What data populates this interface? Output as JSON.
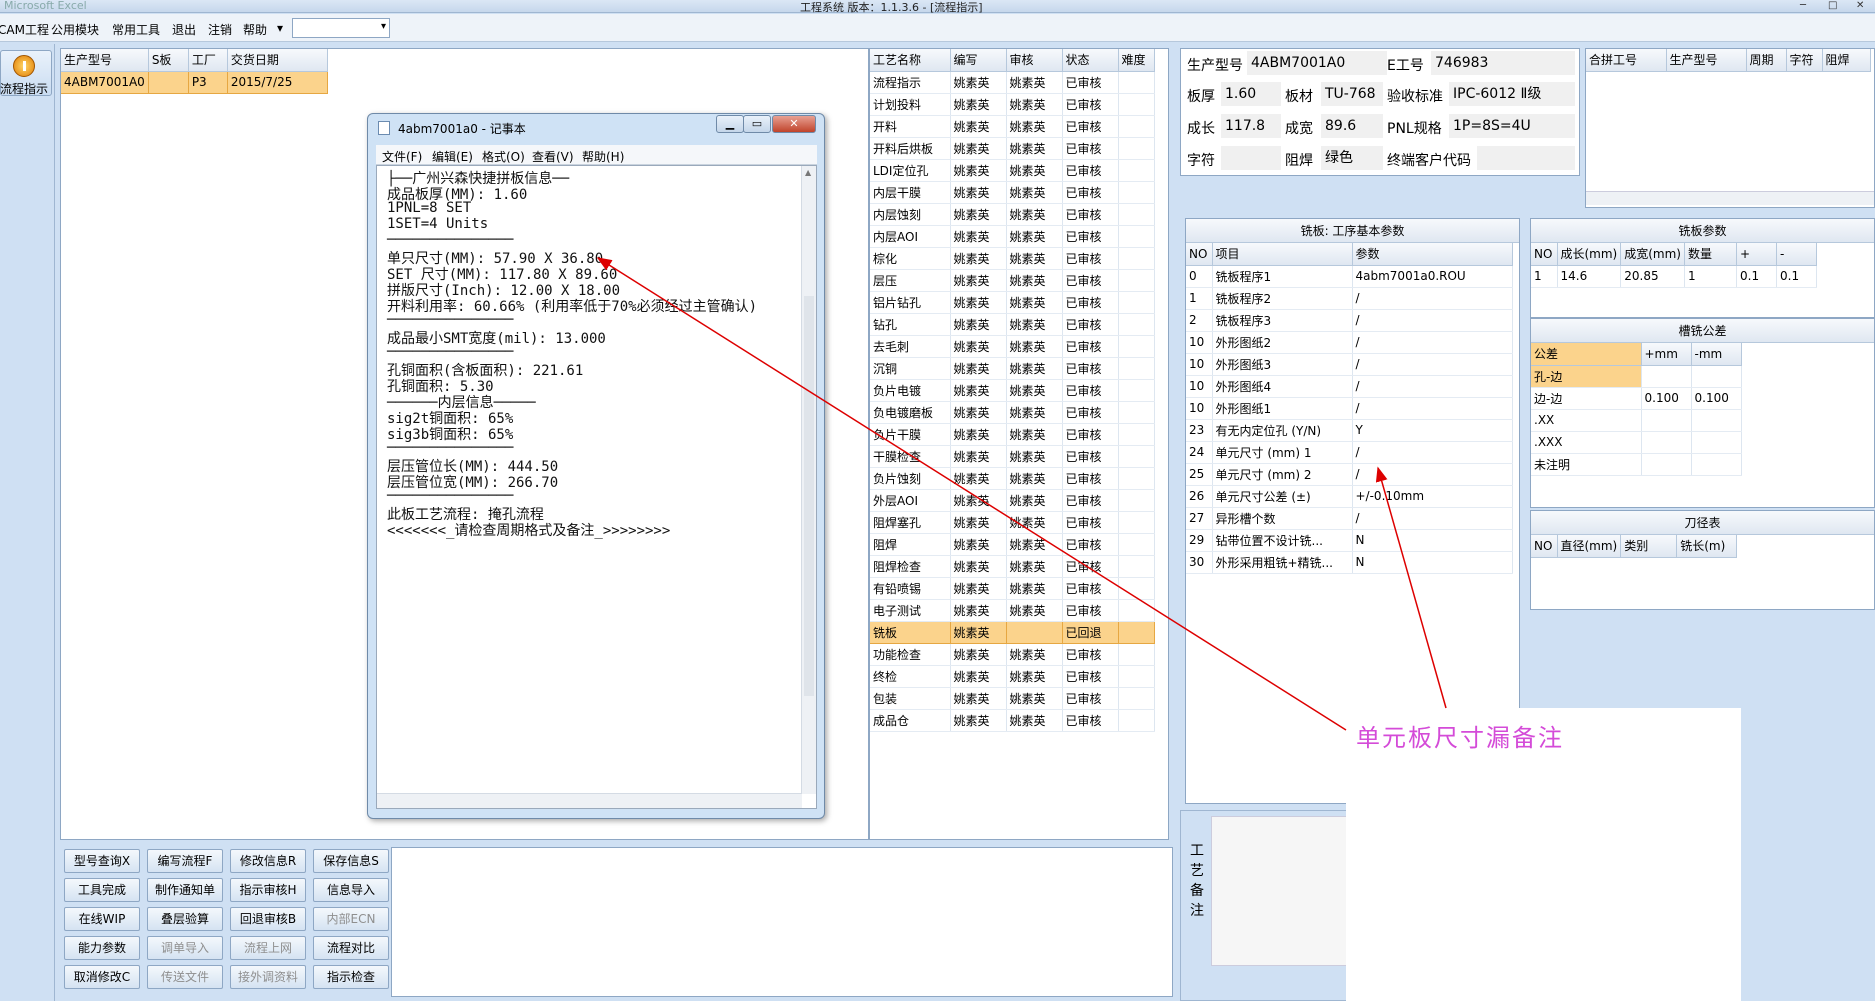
{
  "titlebar": {
    "left_text": "Microsoft Excel",
    "title": "工程系统   版本：1.1.3.6 - [流程指示]",
    "min": "─",
    "max": "□",
    "close": "✕"
  },
  "menu": [
    "CAM工程",
    "公用模块",
    "常用工具",
    "退出",
    "注销",
    "帮助",
    "▾"
  ],
  "combo_value": "",
  "nav": {
    "label": "流程指示"
  },
  "orders": {
    "headers": [
      "生产型号",
      "S板",
      "工厂",
      "交货日期"
    ],
    "rows": [
      [
        "4ABM7001A0",
        "",
        "P3",
        "2015/7/25"
      ]
    ]
  },
  "notepad": {
    "title": "4abm7001a0 - 记事本",
    "min": "▁",
    "max": "▭",
    "close": "✕",
    "menu": [
      "文件(F)",
      "编辑(E)",
      "格式(O)",
      "查看(V)",
      "帮助(H)"
    ],
    "lines": [
      "├──广州兴森快捷拼板信息──",
      "成品板厚(MM): 1.60",
      "1PNL=8 SET",
      "1SET=4 Units",
      "───────────────",
      "单只尺寸(MM): 57.90 X 36.80",
      "SET 尺寸(MM): 117.80 X 89.60",
      "拼版尺寸(Inch): 12.00 X 18.00",
      "开料利用率: 60.66% (利用率低于70%必须经过主管确认)",
      "───────────────",
      "成品最小SMT宽度(mil): 13.000",
      "───────────────",
      "孔铜面积(含板面积): 221.61",
      "孔铜面积: 5.30",
      "──────内层信息─────",
      "sig2t铜面积: 65%",
      "sig3b铜面积: 65%",
      "───────────────",
      "层压管位长(MM): 444.50",
      "层压管位宽(MM): 266.70",
      "───────────────",
      "此板工艺流程: 掩孔流程",
      "<<<<<<<_请检查周期格式及备注_>>>>>>>>"
    ]
  },
  "process": {
    "headers": [
      "工艺名称",
      "编写",
      "审核",
      "状态",
      "难度"
    ],
    "rows": [
      [
        "流程指示",
        "姚素英",
        "姚素英",
        "已审核",
        ""
      ],
      [
        "计划投料",
        "姚素英",
        "姚素英",
        "已审核",
        ""
      ],
      [
        "开料",
        "姚素英",
        "姚素英",
        "已审核",
        ""
      ],
      [
        "开料后烘板",
        "姚素英",
        "姚素英",
        "已审核",
        ""
      ],
      [
        "LDI定位孔",
        "姚素英",
        "姚素英",
        "已审核",
        ""
      ],
      [
        "内层干膜",
        "姚素英",
        "姚素英",
        "已审核",
        ""
      ],
      [
        "内层蚀刻",
        "姚素英",
        "姚素英",
        "已审核",
        ""
      ],
      [
        "内层AOI",
        "姚素英",
        "姚素英",
        "已审核",
        ""
      ],
      [
        "棕化",
        "姚素英",
        "姚素英",
        "已审核",
        ""
      ],
      [
        "层压",
        "姚素英",
        "姚素英",
        "已审核",
        ""
      ],
      [
        "铝片钻孔",
        "姚素英",
        "姚素英",
        "已审核",
        ""
      ],
      [
        "钻孔",
        "姚素英",
        "姚素英",
        "已审核",
        ""
      ],
      [
        "去毛刺",
        "姚素英",
        "姚素英",
        "已审核",
        ""
      ],
      [
        "沉铜",
        "姚素英",
        "姚素英",
        "已审核",
        ""
      ],
      [
        "负片电镀",
        "姚素英",
        "姚素英",
        "已审核",
        ""
      ],
      [
        "负电镀磨板",
        "姚素英",
        "姚素英",
        "已审核",
        ""
      ],
      [
        "负片干膜",
        "姚素英",
        "姚素英",
        "已审核",
        ""
      ],
      [
        "干膜检查",
        "姚素英",
        "姚素英",
        "已审核",
        ""
      ],
      [
        "负片蚀刻",
        "姚素英",
        "姚素英",
        "已审核",
        ""
      ],
      [
        "外层AOI",
        "姚素英",
        "姚素英",
        "已审核",
        ""
      ],
      [
        "阻焊塞孔",
        "姚素英",
        "姚素英",
        "已审核",
        ""
      ],
      [
        "阻焊",
        "姚素英",
        "姚素英",
        "已审核",
        ""
      ],
      [
        "阻焊检查",
        "姚素英",
        "姚素英",
        "已审核",
        ""
      ],
      [
        "有铅喷锡",
        "姚素英",
        "姚素英",
        "已审核",
        ""
      ],
      [
        "电子测试",
        "姚素英",
        "姚素英",
        "已审核",
        ""
      ],
      [
        "铣板",
        "姚素英",
        "",
        "已回退",
        ""
      ],
      [
        "功能检查",
        "姚素英",
        "姚素英",
        "已审核",
        ""
      ],
      [
        "终检",
        "姚素英",
        "姚素英",
        "已审核",
        ""
      ],
      [
        "包装",
        "姚素英",
        "姚素英",
        "已审核",
        ""
      ],
      [
        "成品仓",
        "姚素英",
        "姚素英",
        "已审核",
        ""
      ]
    ],
    "selected_index": 25
  },
  "info": {
    "生产型号": "4ABM7001A0",
    "E工号": "746983",
    "板厚": "1.60",
    "板材": "TU-768",
    "验收标准": "IPC-6012 Ⅱ级",
    "成长": "117.8",
    "成宽": "89.6",
    "PNL规格": "1P=8S=4U",
    "字符": "",
    "阻焊": "绿色",
    "终端客户代码": ""
  },
  "info_labels": {
    "a": "生产型号",
    "b": "E工号",
    "c": "板厚",
    "d": "板材",
    "e": "验收标准",
    "f": "成长",
    "g": "成宽",
    "h": "PNL规格",
    "i": "字符",
    "j": "阻焊",
    "k": "终端客户代码"
  },
  "combine": {
    "headers": [
      "合拼工号",
      "生产型号",
      "周期",
      "字符",
      "阻焊"
    ]
  },
  "params": {
    "title": "铣板: 工序基本参数",
    "headers": [
      "NO",
      "项目",
      "参数"
    ],
    "rows": [
      [
        "0",
        "铣板程序1",
        "4abm7001a0.ROU"
      ],
      [
        "1",
        "铣板程序2",
        "/"
      ],
      [
        "2",
        "铣板程序3",
        "/"
      ],
      [
        "10",
        "外形图纸2",
        "/"
      ],
      [
        "10",
        "外形图纸3",
        "/"
      ],
      [
        "10",
        "外形图纸4",
        "/"
      ],
      [
        "10",
        "外形图纸1",
        "/"
      ],
      [
        "23",
        "有无内定位孔 (Y/N)",
        "Y"
      ],
      [
        "24",
        "单元尺寸 (mm) 1",
        "/"
      ],
      [
        "25",
        "单元尺寸 (mm) 2",
        "/"
      ],
      [
        "26",
        "单元尺寸公差 (±)",
        "+/-0.10mm"
      ],
      [
        "27",
        "异形槽个数",
        "/"
      ],
      [
        "29",
        "钻带位置不设计铣...",
        "N"
      ],
      [
        "30",
        "外形采用粗铣+精铣...",
        "N"
      ]
    ]
  },
  "mill": {
    "title": "铣板参数",
    "headers": [
      "NO",
      "成长(mm)",
      "成宽(mm)",
      "数量",
      "+",
      "-"
    ],
    "rows": [
      [
        "1",
        "14.6",
        "20.85",
        "1",
        "0.1",
        "0.1"
      ]
    ]
  },
  "slot": {
    "title": "槽铣公差",
    "headers": [
      "公差",
      "+mm",
      "-mm"
    ],
    "rows": [
      [
        "孔-边",
        "",
        ""
      ],
      [
        "边-边",
        "0.100",
        "0.100"
      ],
      [
        ".XX",
        "",
        ""
      ],
      [
        ".XXX",
        "",
        ""
      ],
      [
        "未注明",
        "",
        ""
      ]
    ]
  },
  "tool": {
    "title": "刀径表",
    "headers": [
      "NO",
      "直径(mm)",
      "类别",
      "铣长(m)"
    ]
  },
  "remark": {
    "label_chars": [
      "工",
      "艺",
      "备",
      "注"
    ]
  },
  "buttons": [
    [
      "型号查询X",
      "编写流程F",
      "修改信息R",
      "保存信息S"
    ],
    [
      "工具完成",
      "制作通知单",
      "指示审核H",
      "信息导入"
    ],
    [
      "在线WIP",
      "叠层验算",
      "回退审核B",
      "内部ECN"
    ],
    [
      "能力参数",
      "调单导入",
      "流程上网",
      "流程对比"
    ],
    [
      "取消修改C",
      "传送文件",
      "接外调资料",
      "指示检查"
    ]
  ],
  "disabled_buttons": [
    "内部ECN",
    "调单导入",
    "流程上网",
    "传送文件",
    "接外调资料"
  ],
  "annotation": {
    "text": "单元板尺寸漏备注",
    "color": "#d44bd8"
  },
  "colors": {
    "selected": "#fbd38c",
    "background": "#cfe0f3",
    "arrow": "#dd0000"
  }
}
